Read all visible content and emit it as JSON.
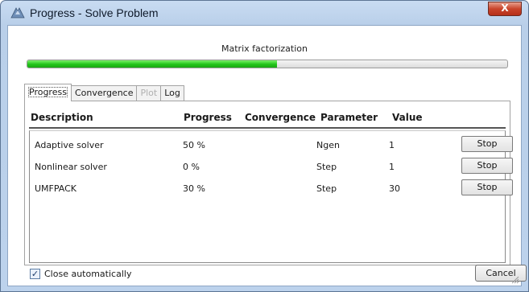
{
  "window": {
    "title": "Progress - Solve Problem",
    "close_label": "X"
  },
  "status": {
    "text": "Matrix factorization",
    "progress_fraction": 0.52
  },
  "tabs": [
    {
      "label": "Progress",
      "active": true
    },
    {
      "label": "Convergence",
      "active": false
    },
    {
      "label": "Plot",
      "active": false,
      "disabled": true
    },
    {
      "label": "Log",
      "active": false
    }
  ],
  "table": {
    "columns": [
      "Description",
      "Progress",
      "Convergence",
      "Parameter",
      "Value"
    ],
    "rows": [
      {
        "description": "Adaptive solver",
        "progress": "50 %",
        "convergence": "",
        "parameter": "Ngen",
        "value": "1",
        "button": "Stop"
      },
      {
        "description": "Nonlinear solver",
        "progress": "0 %",
        "convergence": "",
        "parameter": "Step",
        "value": "1",
        "button": "Stop"
      },
      {
        "description": "UMFPACK",
        "progress": "30 %",
        "convergence": "",
        "parameter": "Step",
        "value": "30",
        "button": "Stop"
      }
    ]
  },
  "footer": {
    "close_automatically_label": "Close automatically",
    "close_automatically_checked": true,
    "checkmark": "✓",
    "cancel_label": "Cancel"
  },
  "colors": {
    "progress_green": "#22c41a",
    "title_bar": "#c9dcf2",
    "close_red": "#c9442b"
  }
}
